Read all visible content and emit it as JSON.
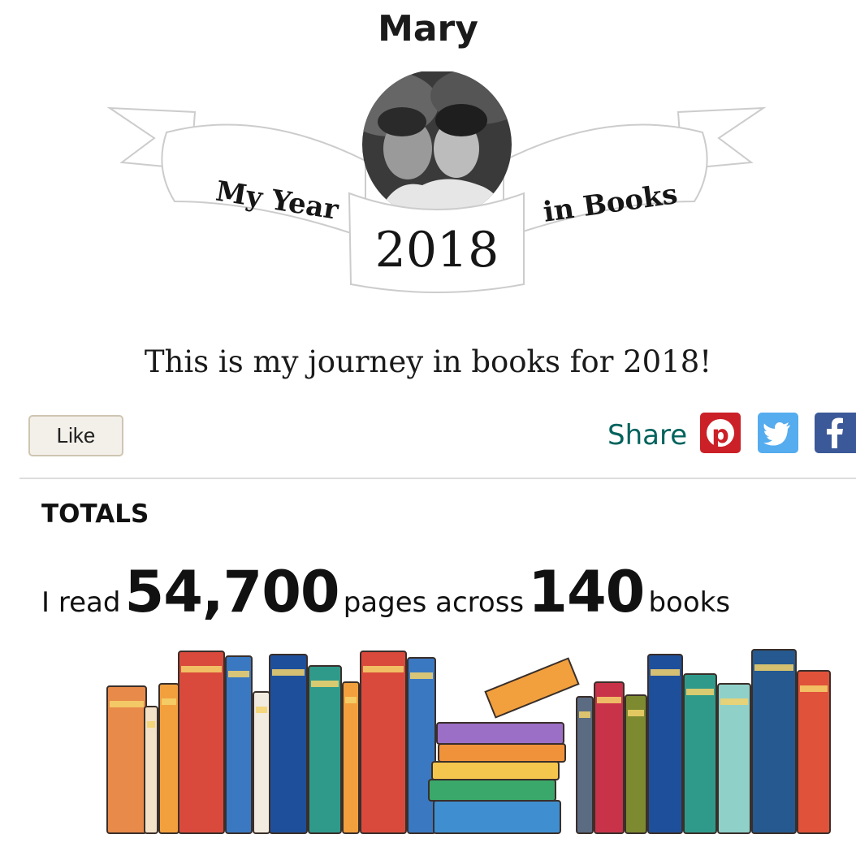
{
  "profile": {
    "name": "Mary"
  },
  "banner": {
    "left_text": "My Year",
    "right_text": "in Books",
    "year": "2018"
  },
  "tagline": "This is my journey in books for 2018!",
  "actions": {
    "like_label": "Like",
    "share_label": "Share"
  },
  "social": {
    "pinterest": "pinterest-icon",
    "twitter": "twitter-icon",
    "facebook": "facebook-icon"
  },
  "totals": {
    "section_title": "TOTALS",
    "prefix": "I read",
    "pages": "54,700",
    "middle": "pages across",
    "books": "140",
    "suffix": "books"
  },
  "colors": {
    "share_text": "#00635d",
    "pinterest": "#cb2027",
    "twitter": "#55acee",
    "facebook": "#3b5998",
    "like_border": "#cfc5b2"
  }
}
